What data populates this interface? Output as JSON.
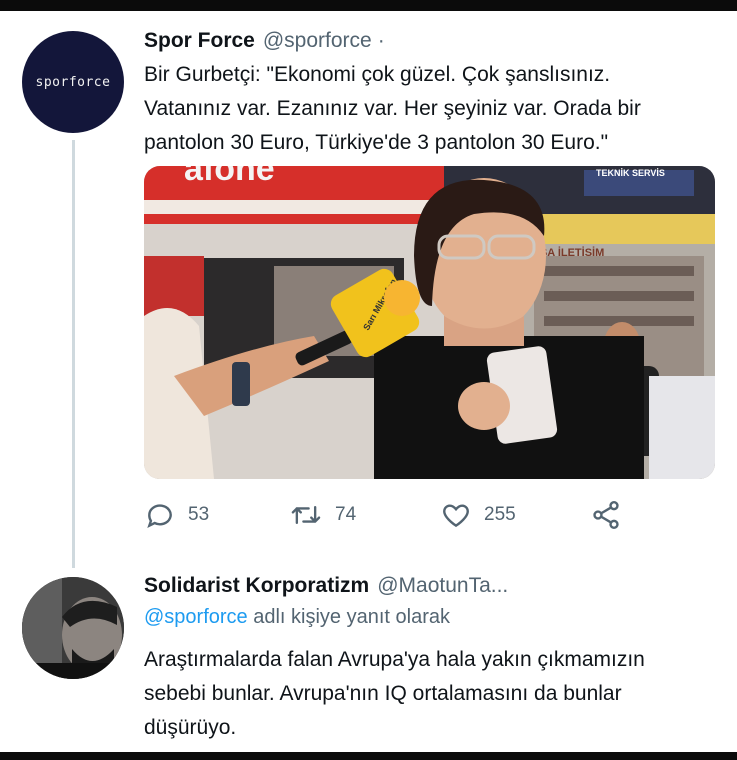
{
  "tweet": {
    "author_name": "Spor Force",
    "handle": "@sporforce",
    "separator": "·",
    "avatar_text": "sporforce",
    "text_lines": [
      "Bir Gurbetçi: \"Ekonomi çok güzel. Çok şanslısınız.",
      "Vatanınız var. Ezanınız var. Her şeyiniz var. Orada bir",
      "pantolon 30 Euro, Türkiye'de 3 pantolon 30 Euro.\""
    ],
    "media": {
      "sign_text": "TEKNİK SERVİS",
      "sign_text_2": "BAŞA İLETİŞİM",
      "mic_text": "Sarı Mikrofon"
    },
    "actions": {
      "reply_count": "53",
      "retweet_count": "74",
      "like_count": "255"
    }
  },
  "reply": {
    "author_name": "Solidarist Korporatizm",
    "handle": "@MaotunTa...",
    "reply_to_handle": "@sporforce",
    "reply_to_text": " adlı kişiye yanıt olarak",
    "text_lines": [
      "Araştırmalarda falan Avrupa'ya hala yakın çıkmamızın",
      "sebebi bunlar. Avrupa'nın IQ ortalamasını da bunlar",
      "düşürüyo."
    ]
  },
  "icons": {
    "reply": "reply-icon",
    "retweet": "retweet-icon",
    "like": "like-icon",
    "share": "share-icon"
  }
}
